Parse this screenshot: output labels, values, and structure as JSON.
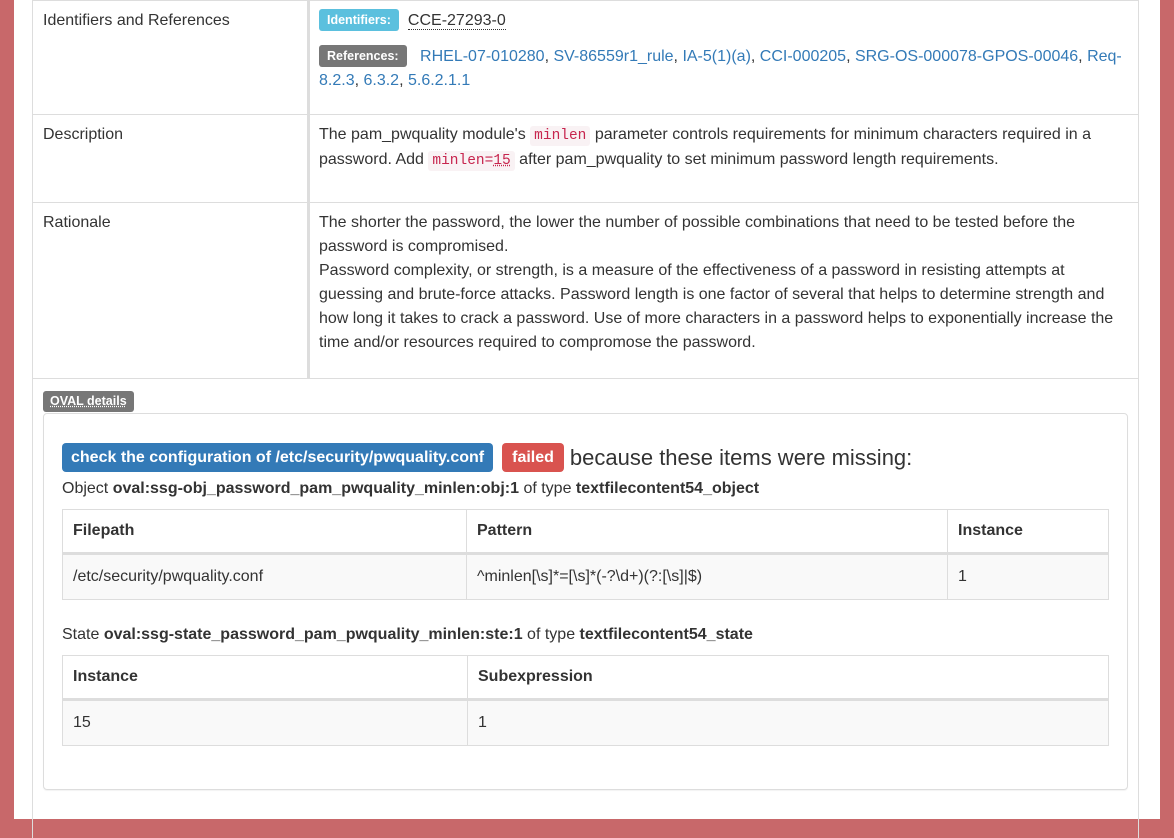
{
  "rows": {
    "identifiers": {
      "label": "Identifiers and References",
      "identifiers_badge": "Identifiers:",
      "cce": "CCE-27293-0",
      "references_badge": "References:",
      "references": [
        "RHEL-07-010280",
        "SV-86559r1_rule",
        "IA-5(1)(a)",
        "CCI-000205",
        "SRG-OS-000078-GPOS-00046",
        "Req-8.2.3",
        "6.3.2",
        "5.6.2.1.1"
      ]
    },
    "description": {
      "label": "Description",
      "text_1": "The pam_pwquality module's ",
      "code_1": "minlen",
      "text_2": " parameter controls requirements for minimum characters required in a password. Add ",
      "code_2a": "minlen=",
      "code_2b": "15",
      "text_3": " after pam_pwquality to set minimum password length requirements."
    },
    "rationale": {
      "label": "Rationale",
      "para_1": "The shorter the password, the lower the number of possible combinations that need to be tested before the password is compromised.",
      "para_2": "Password complexity, or strength, is a measure of the effectiveness of a password in resisting attempts at guessing and brute-force attacks. Password length is one factor of several that helps to determine strength and how long it takes to crack a password. Use of more characters in a password helps to exponentially increase the time and/or resources required to compromose the password."
    }
  },
  "oval": {
    "label": "OVAL details",
    "check_label": "check the configuration of /etc/security/pwquality.conf",
    "status": "failed",
    "because": "because these items were missing:",
    "object_prefix": "Object ",
    "object_id": "oval:ssg-obj_password_pam_pwquality_minlen:obj:1",
    "of_type": " of type ",
    "object_type": "textfilecontent54_object",
    "object_table": {
      "headers": [
        "Filepath",
        "Pattern",
        "Instance"
      ],
      "row": [
        "/etc/security/pwquality.conf",
        "^minlen[\\s]*=[\\s]*(-?\\d+)(?:[\\s]|$)",
        "1"
      ]
    },
    "state_prefix": "State ",
    "state_id": "oval:ssg-state_password_pam_pwquality_minlen:ste:1",
    "state_type": "textfilecontent54_state",
    "state_table": {
      "headers": [
        "Instance",
        "Subexpression"
      ],
      "row": [
        "15",
        "1"
      ]
    }
  },
  "colors": {
    "background_frame": "#c8686a",
    "info": "#5bc0de",
    "primary": "#337ab7",
    "danger": "#d9534f",
    "default": "#777777"
  }
}
